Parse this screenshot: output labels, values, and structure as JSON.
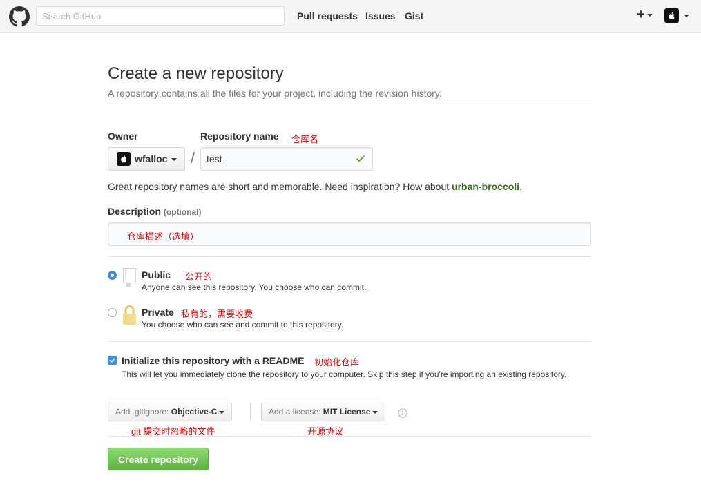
{
  "header": {
    "logo_icon": "github-octocat-icon",
    "search_placeholder": "Search GitHub",
    "nav": [
      "Pull requests",
      "Issues",
      "Gist"
    ],
    "new_menu_label": "+",
    "user_avatar_icon": "apple-avatar-icon"
  },
  "page": {
    "title": "Create a new repository",
    "subtitle": "A repository contains all the files for your project, including the revision history."
  },
  "form": {
    "owner_label": "Owner",
    "owner_value": "wfalloc",
    "separator": "/",
    "repo_name_label": "Repository name",
    "repo_name_note": "仓库名",
    "repo_name_value": "test",
    "name_hint_prefix": "Great repository names are short and memorable. Need inspiration? How about ",
    "name_hint_suggestion": "urban-broccoli",
    "name_hint_suffix": ".",
    "description_label": "Description",
    "description_optional": "(optional)",
    "description_note": "仓库描述（选填）",
    "visibility": {
      "selected": "public",
      "public_title": "Public",
      "public_note": "公开的",
      "public_desc": "Anyone can see this repository. You choose who can commit.",
      "private_title": "Private",
      "private_note": "私有的，需要收费",
      "private_desc": "You choose who can see and commit to this repository."
    },
    "readme": {
      "checked": true,
      "label": "Initialize this repository with a README",
      "note": "初始化仓库",
      "desc": "This will let you immediately clone the repository to your computer. Skip this step if you're importing an existing repository."
    },
    "gitignore_prefix": "Add .gitignore:",
    "gitignore_value": "Objective-C",
    "gitignore_note": "git 提交时忽略的文件",
    "license_prefix": "Add a license:",
    "license_value": "MIT License",
    "license_note": "开源协议",
    "submit_label": "Create repository"
  },
  "colors": {
    "accent_green": "#60b044",
    "suggestion_green": "#3c6e1f",
    "annotation_red": "#ee0000",
    "radio_blue": "#3b8fe7"
  }
}
